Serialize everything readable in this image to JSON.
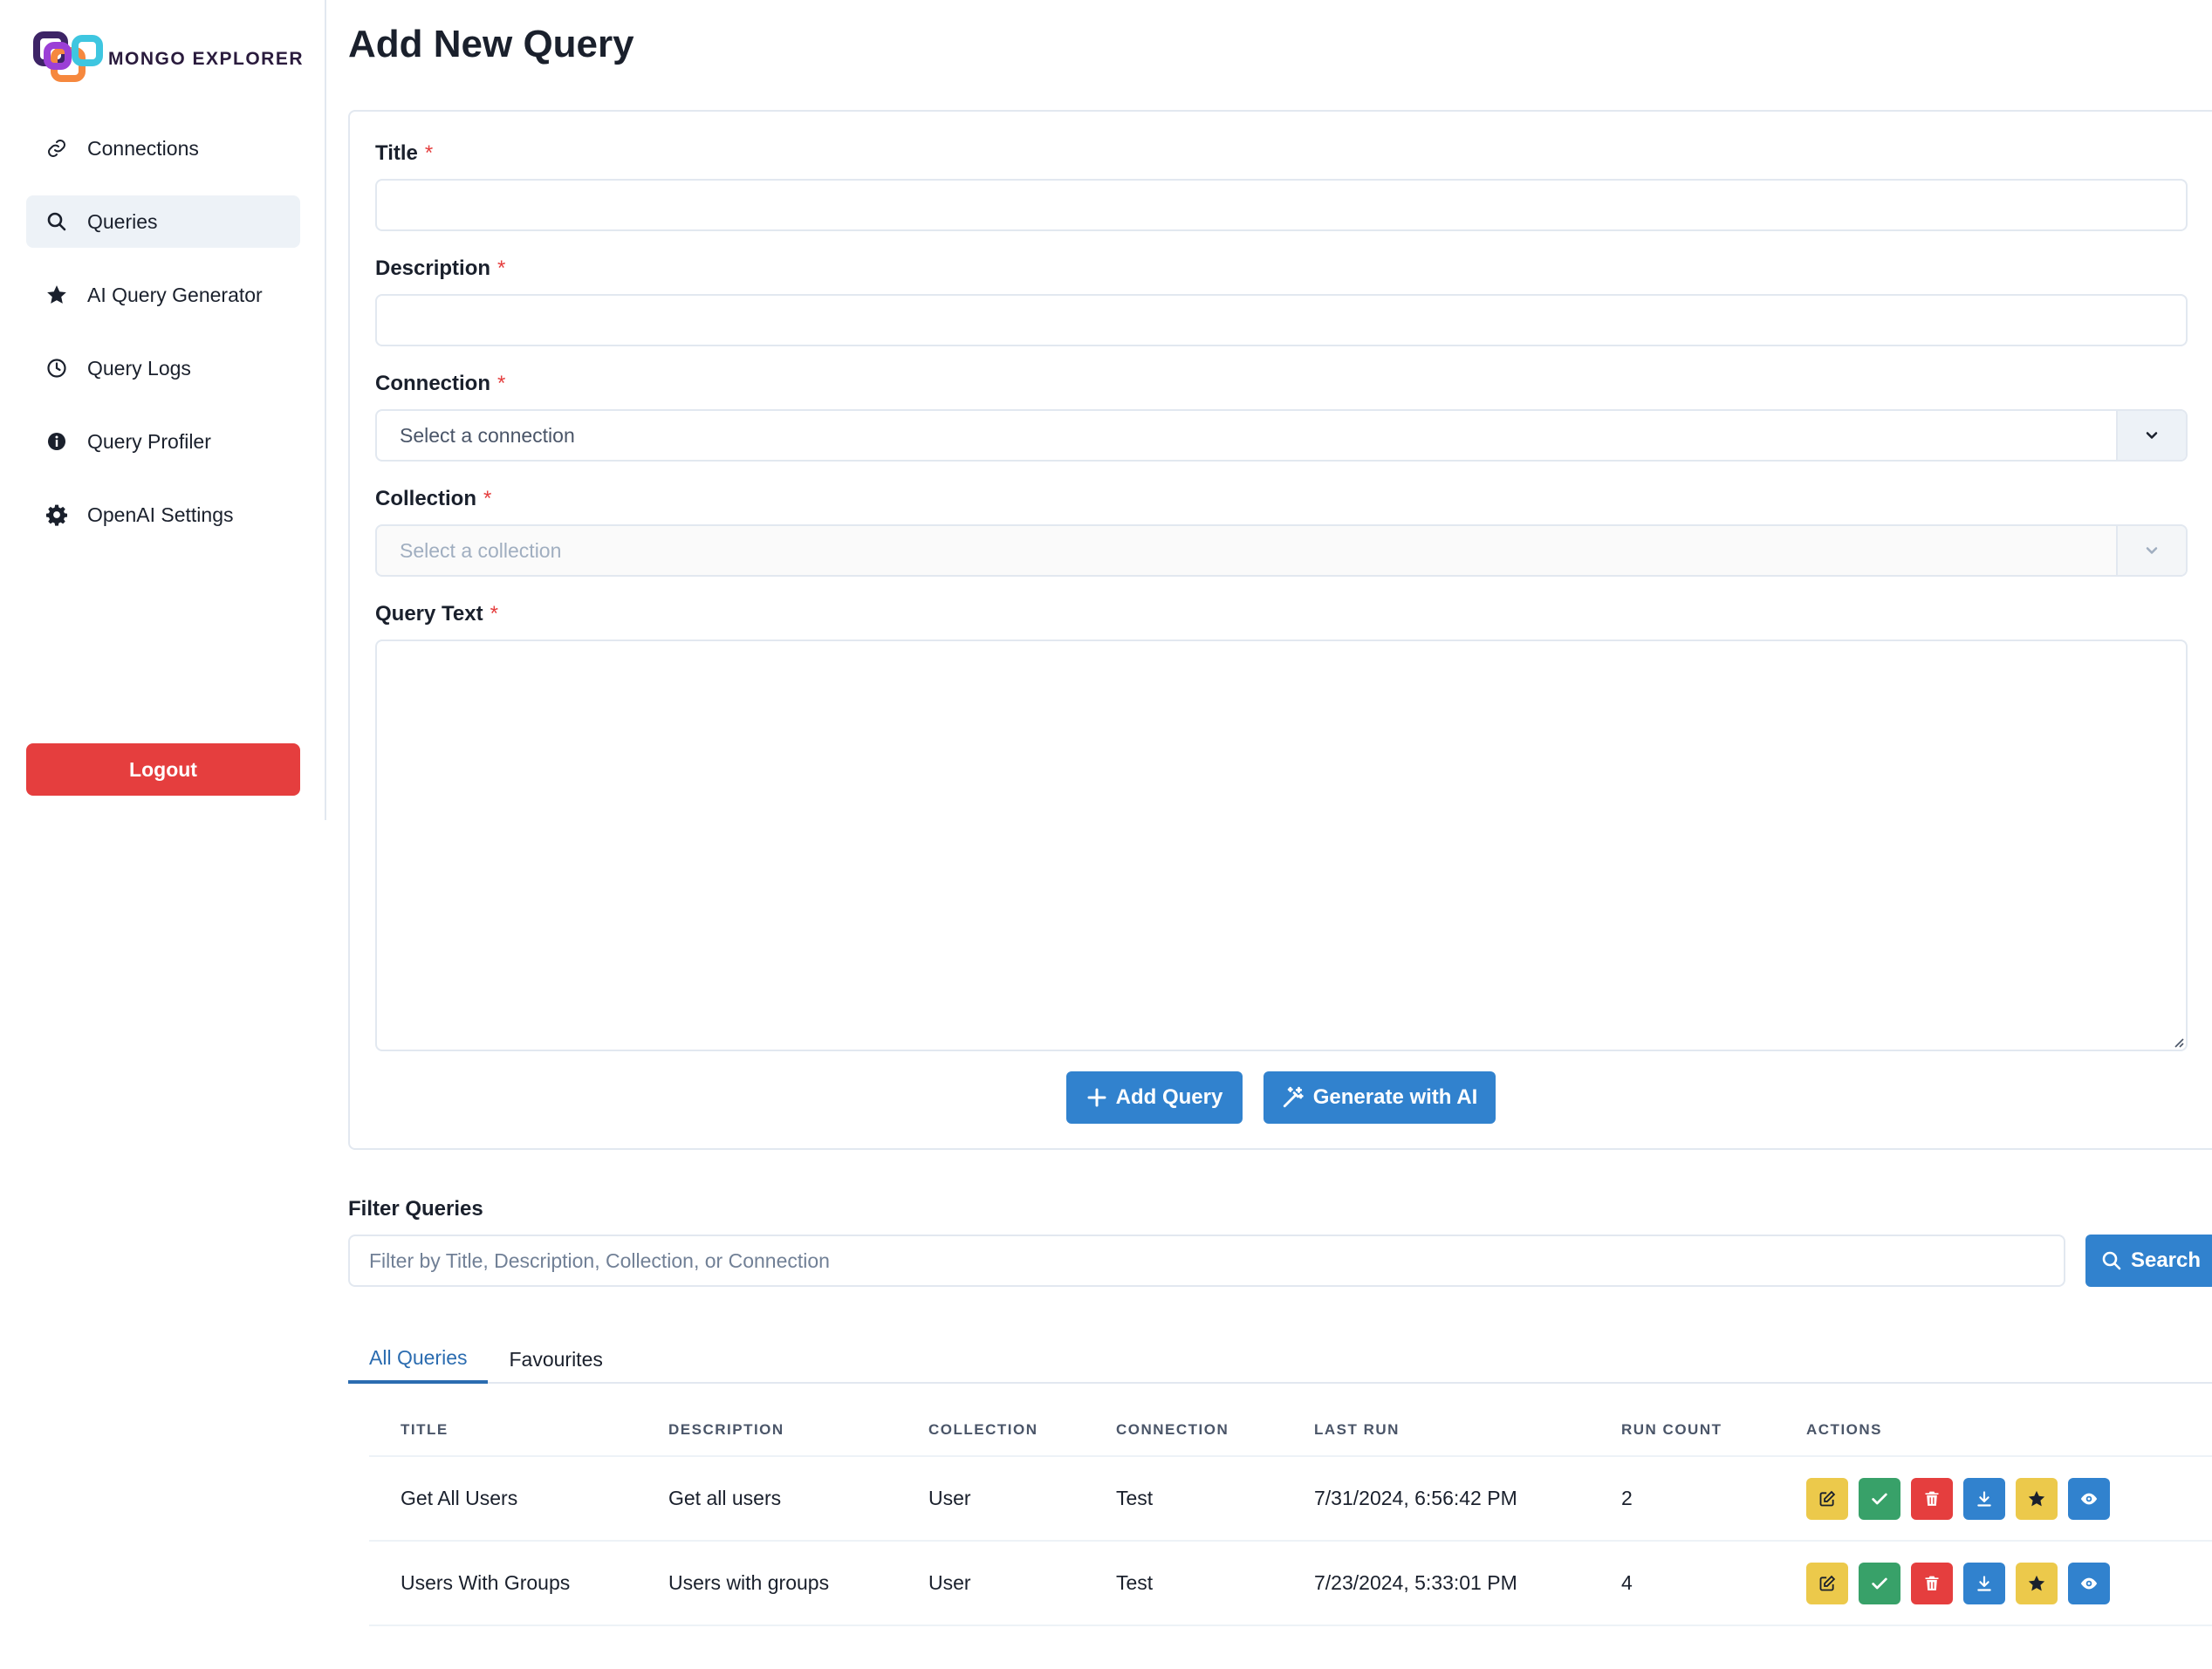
{
  "app": {
    "logo_text": "MONGO EXPLORER"
  },
  "sidebar": {
    "items": [
      {
        "label": "Connections",
        "icon": "link-icon",
        "active": false
      },
      {
        "label": "Queries",
        "icon": "search-icon",
        "active": true
      },
      {
        "label": "AI Query Generator",
        "icon": "star-icon",
        "active": false
      },
      {
        "label": "Query Logs",
        "icon": "clock-icon",
        "active": false
      },
      {
        "label": "Query Profiler",
        "icon": "info-icon",
        "active": false
      },
      {
        "label": "OpenAI Settings",
        "icon": "gear-icon",
        "active": false
      }
    ],
    "logout_label": "Logout"
  },
  "page": {
    "title": "Add New Query"
  },
  "form": {
    "title_label": "Title",
    "description_label": "Description",
    "connection_label": "Connection",
    "connection_placeholder": "Select a connection",
    "collection_label": "Collection",
    "collection_placeholder": "Select a collection",
    "query_text_label": "Query Text",
    "required_mark": "*",
    "add_button": "Add Query",
    "generate_button": "Generate with AI"
  },
  "filter": {
    "label": "Filter Queries",
    "placeholder": "Filter by Title, Description, Collection, or Connection",
    "search_button": "Search"
  },
  "tabs": [
    {
      "label": "All Queries",
      "active": true
    },
    {
      "label": "Favourites",
      "active": false
    }
  ],
  "table": {
    "headers": [
      "Title",
      "Description",
      "Collection",
      "Connection",
      "Last Run",
      "Run Count",
      "Actions"
    ],
    "rows": [
      {
        "title": "Get All Users",
        "description": "Get all users",
        "collection": "User",
        "connection": "Test",
        "last_run": "7/31/2024, 6:56:42 PM",
        "run_count": "2"
      },
      {
        "title": "Users With Groups",
        "description": "Users with groups",
        "collection": "User",
        "connection": "Test",
        "last_run": "7/23/2024, 5:33:01 PM",
        "run_count": "4"
      }
    ]
  },
  "colors": {
    "primary": "#3182ce",
    "danger": "#e53e3e",
    "success": "#38a169",
    "warning": "#ecc94b"
  }
}
